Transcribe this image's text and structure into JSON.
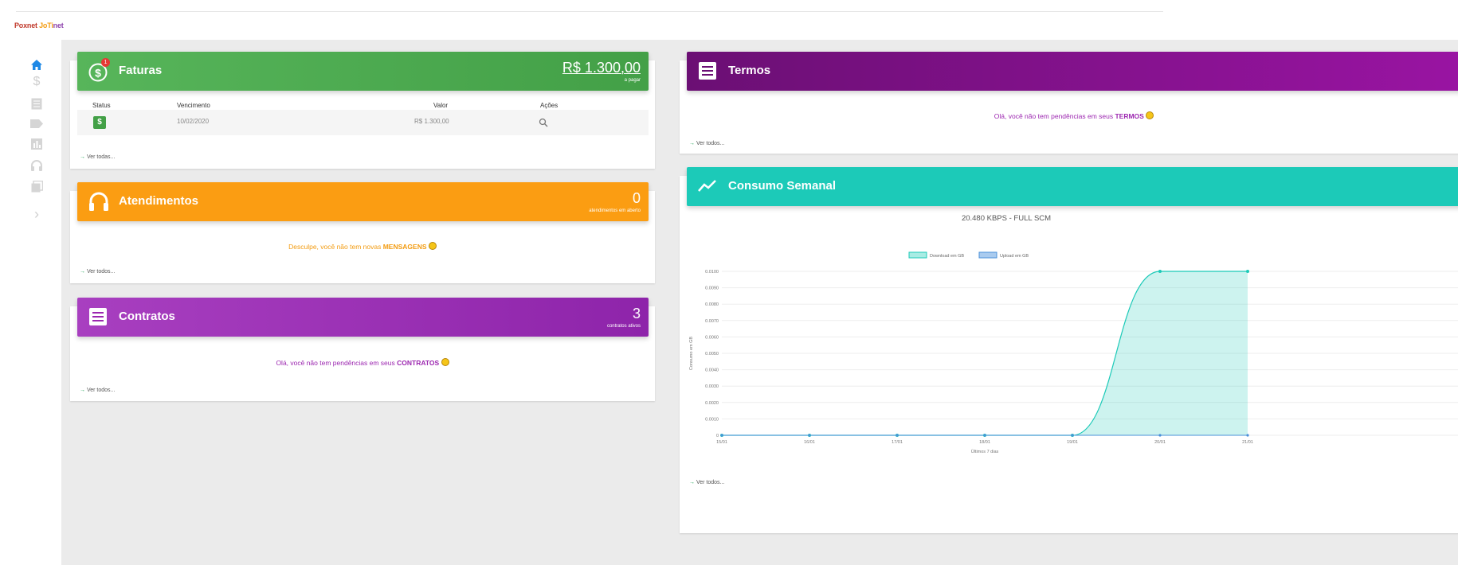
{
  "logo": {
    "part1": "Poxnet",
    "part2": "JoTi",
    "part3": "net"
  },
  "colors": {
    "green": "#4cae4c",
    "orange": "#fb9d12",
    "purple": "#9c27b0",
    "darkpurple": "#6b0f74",
    "teal": "#1ccab8",
    "background": "#ebebeb"
  },
  "sidebar": {
    "items": [
      "home-icon",
      "dollar-icon",
      "document-icon",
      "tag-icon",
      "chart-icon",
      "headset-icon",
      "copy-icon",
      "chevron-right-icon"
    ]
  },
  "faturas": {
    "title": "Faturas",
    "badge": "1",
    "amount": "R$ 1.300,00",
    "amount_sub": "a pagar",
    "columns": [
      "Status",
      "Vencimento",
      "Valor",
      "Ações"
    ],
    "rows": [
      {
        "status": "$",
        "vencimento": "10/02/2020",
        "valor": "R$ 1.300,00"
      }
    ],
    "ver_todas": "Ver todas..."
  },
  "atendimentos": {
    "title": "Atendimentos",
    "count": "0",
    "count_sub": "atendimentos em aberto",
    "msg_pre": "Desculpe, você não tem novas",
    "msg_key": "MENSAGENS",
    "ver_todos": "Ver todos..."
  },
  "contratos": {
    "title": "Contratos",
    "count": "3",
    "count_sub": "contratos ativos",
    "msg_pre": "Olá, você não tem pendências em seus",
    "msg_key": "CONTRATOS",
    "ver_todos": "Ver todos..."
  },
  "termos": {
    "title": "Termos",
    "msg_pre": "Olá, você não tem pendências em seus",
    "msg_key": "TERMOS",
    "ver_todos": "Ver todos..."
  },
  "consumo": {
    "title": "Consumo Semanal",
    "plan": "20.480 KBPS - FULL SCM",
    "ver_todos": "Ver todos..."
  },
  "chart_data": {
    "type": "area",
    "legend": [
      "Download em GB",
      "Upload em GB"
    ],
    "legend_position": "top",
    "x": [
      "15/01",
      "16/01",
      "17/01",
      "18/01",
      "19/01",
      "20/01",
      "21/01"
    ],
    "series": [
      {
        "name": "Download em GB",
        "values": [
          0,
          0,
          0,
          0,
          0,
          0.01,
          0.01
        ],
        "color": "#1ccab8"
      },
      {
        "name": "Upload em GB",
        "values": [
          0,
          0,
          0,
          0,
          0,
          0,
          0
        ],
        "color": "#4a90d9"
      }
    ],
    "yticks": [
      "0",
      "0.0010",
      "0.0020",
      "0.0030",
      "0.0040",
      "0.0050",
      "0.0060",
      "0.0070",
      "0.0080",
      "0.0090",
      "0.0100"
    ],
    "ylim": [
      0,
      0.01
    ],
    "ylabel": "Consumo em GB",
    "xlabel": "Últimos 7 dias",
    "grid": true
  }
}
